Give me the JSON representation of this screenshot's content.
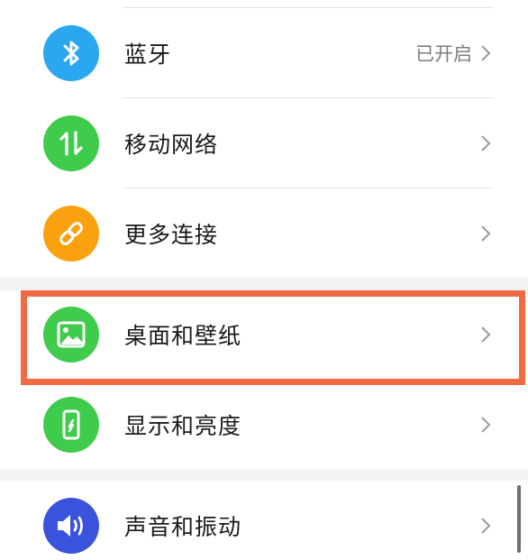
{
  "colors": {
    "bluetooth": "#2aa7f0",
    "mobile_network": "#3fcb4c",
    "more_connections": "#f9a10e",
    "wallpaper": "#3fcb4c",
    "display": "#3fcb4c",
    "sound": "#3a53dd",
    "highlight": "#f26a43"
  },
  "settings": {
    "bluetooth": {
      "label": "蓝牙",
      "value": "已开启",
      "icon": "bluetooth-icon"
    },
    "mobile_network": {
      "label": "移动网络",
      "icon": "mobile-data-icon"
    },
    "more_connections": {
      "label": "更多连接",
      "icon": "link-icon"
    },
    "wallpaper": {
      "label": "桌面和壁纸",
      "icon": "image-icon"
    },
    "display": {
      "label": "显示和亮度",
      "icon": "phone-brightness-icon"
    },
    "sound": {
      "label": "声音和振动",
      "icon": "speaker-icon"
    }
  }
}
